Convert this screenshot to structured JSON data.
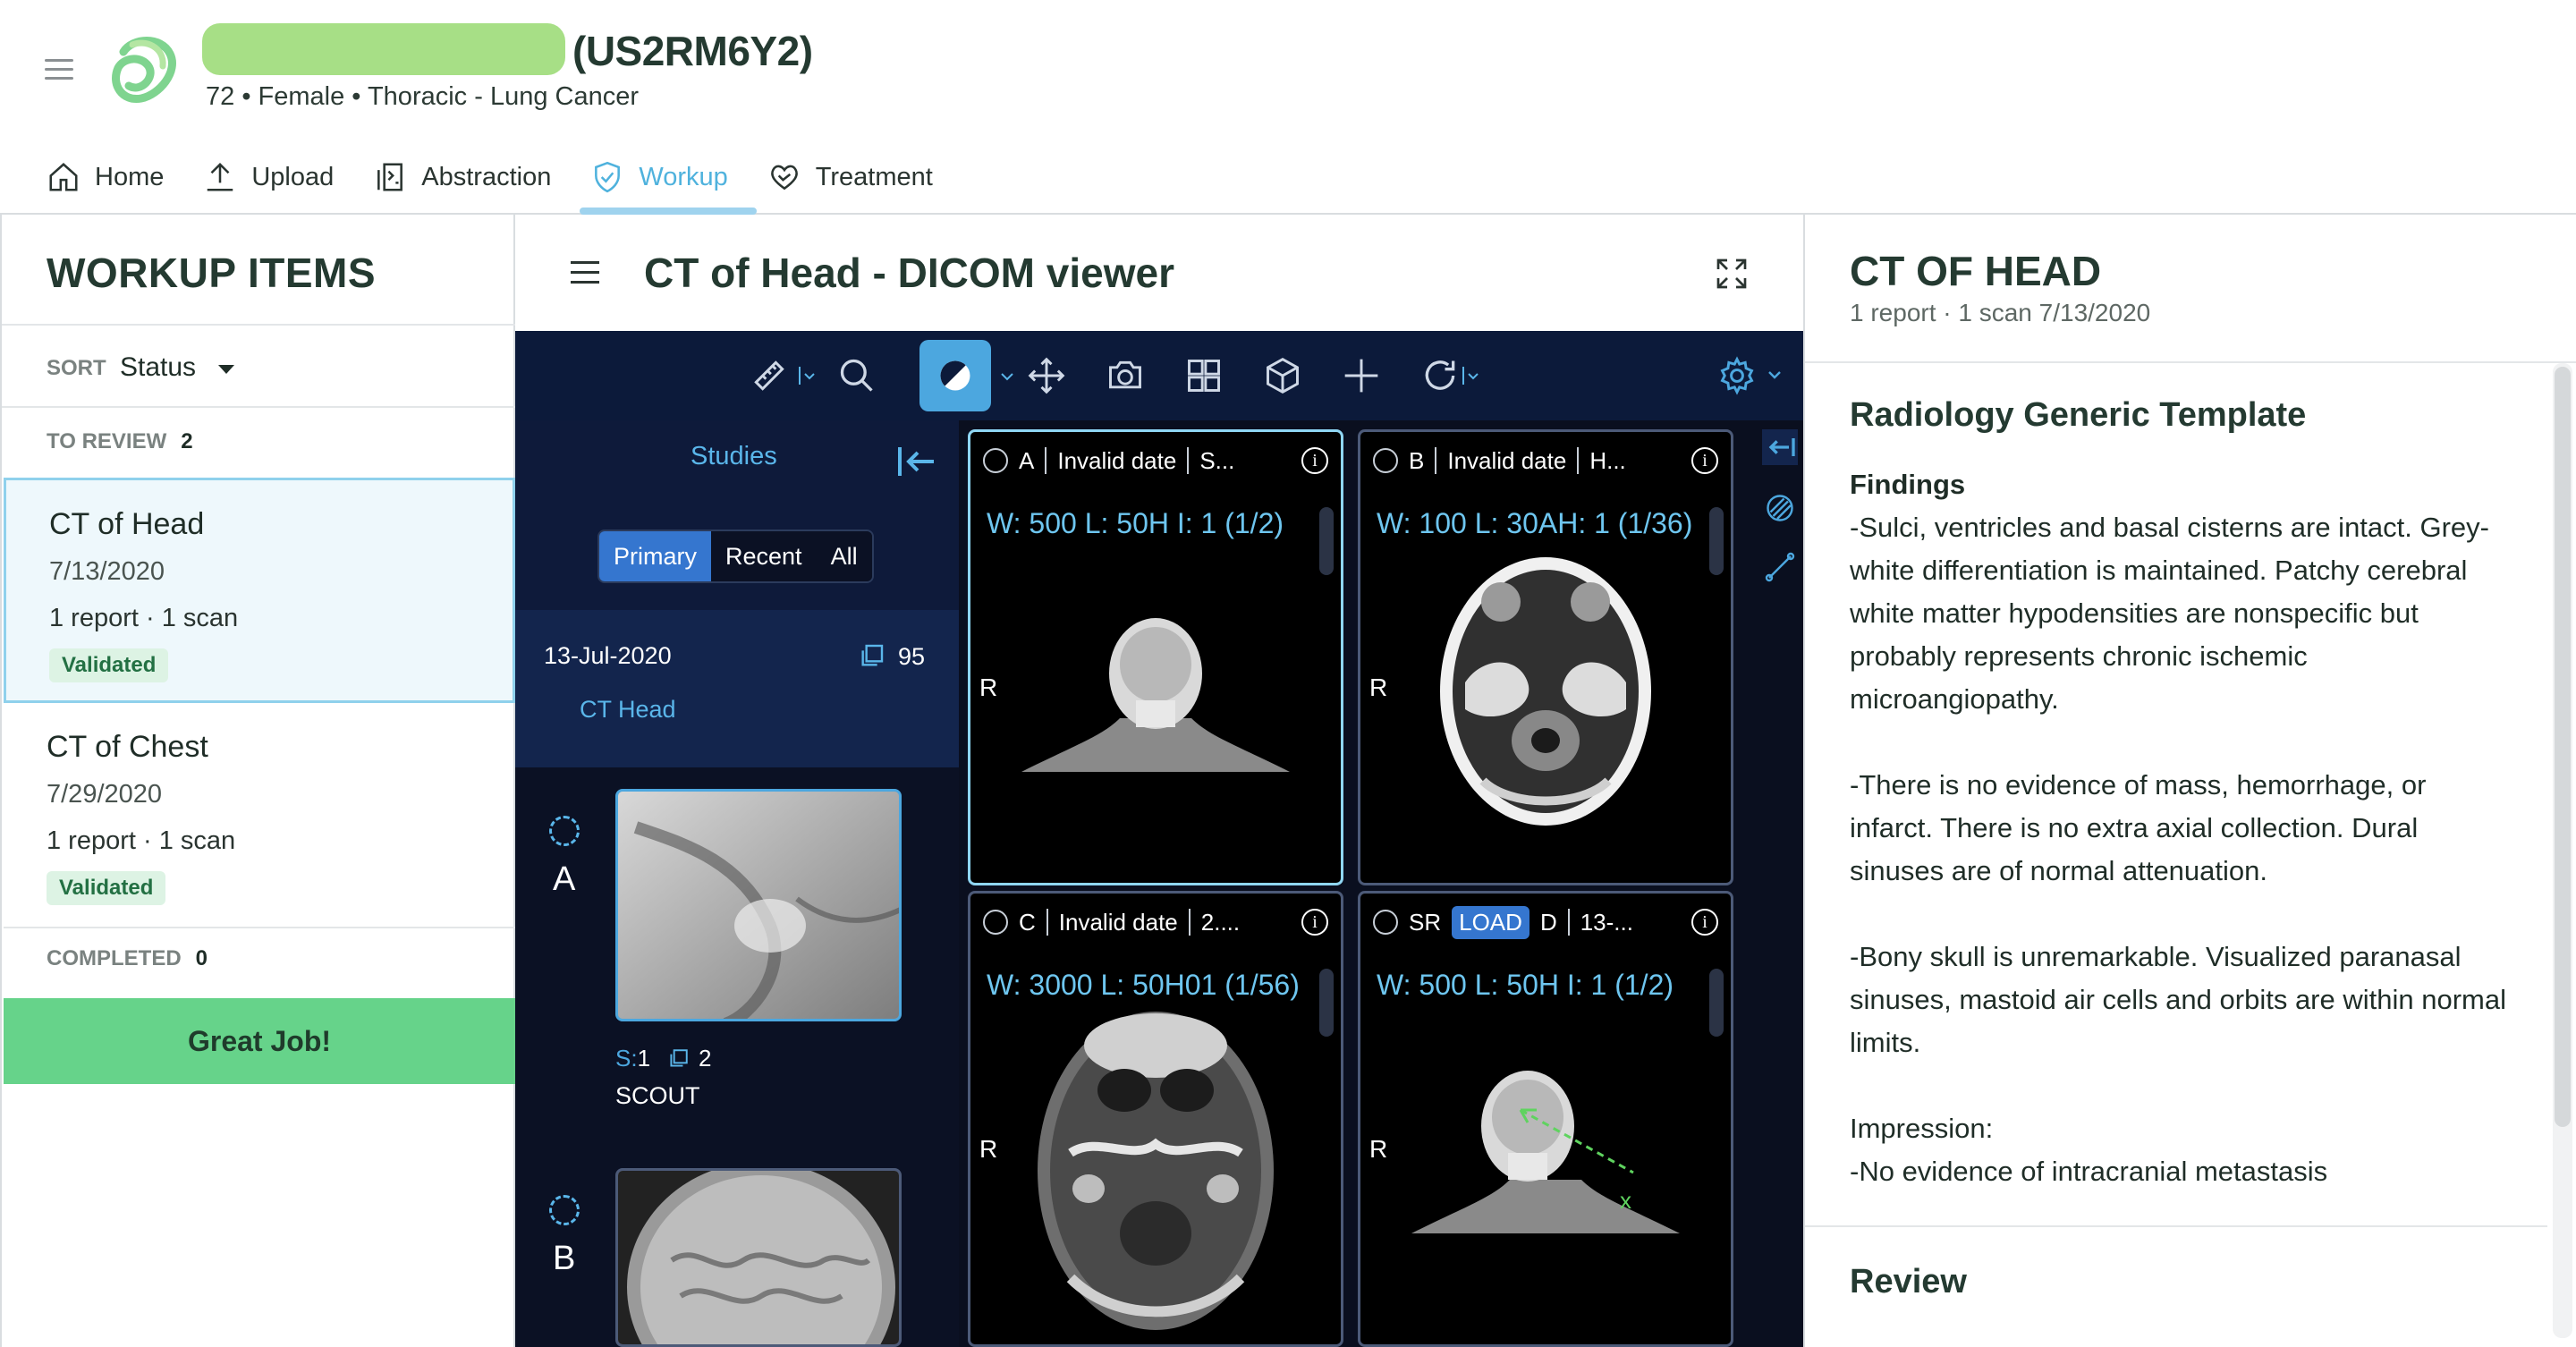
{
  "header": {
    "patient_id": "(US2RM6Y2)",
    "patient_sub": "72 • Female • Thoracic - Lung Cancer"
  },
  "nav": {
    "items": [
      {
        "label": "Home",
        "icon": "home-icon"
      },
      {
        "label": "Upload",
        "icon": "upload-icon"
      },
      {
        "label": "Abstraction",
        "icon": "abstraction-icon"
      },
      {
        "label": "Workup",
        "icon": "shield-check-icon"
      },
      {
        "label": "Treatment",
        "icon": "heart-hand-icon"
      }
    ],
    "active": "Workup",
    "active_color": "#4fb2dd"
  },
  "workup": {
    "title": "WORKUP ITEMS",
    "sort_label": "SORT",
    "sort_value": "Status",
    "to_review_label": "TO REVIEW",
    "to_review_count": "2",
    "items": [
      {
        "title": "CT of Head",
        "date": "7/13/2020",
        "meta": "1 report · 1 scan",
        "status": "Validated"
      },
      {
        "title": "CT of Chest",
        "date": "7/29/2020",
        "meta": "1 report · 1 scan",
        "status": "Validated"
      }
    ],
    "completed_label": "COMPLETED",
    "completed_count": "0",
    "great_job": "Great Job!",
    "accent": "#66d38a"
  },
  "viewer": {
    "title": "CT of Head - DICOM viewer",
    "studies": {
      "title": "Studies",
      "filters": [
        "Primary",
        "Recent",
        "All"
      ],
      "active_filter": "Primary",
      "study_date": "13-Jul-2020",
      "study_count": "95",
      "study_desc": "CT Head"
    },
    "series": [
      {
        "letter": "A",
        "s_label": "S:",
        "s_value": "1",
        "count": "2",
        "name": "SCOUT"
      },
      {
        "letter": "B"
      }
    ],
    "viewports": [
      {
        "label": "A",
        "date": "Invalid date",
        "desc": "S...",
        "wl": "W: 500  L: 50H  I: 1 (1/2)",
        "orient": "R"
      },
      {
        "label": "B",
        "date": "Invalid date",
        "desc": "H...",
        "wl": "W: 100  L: 30AH: 1 (1/36)",
        "orient": "R"
      },
      {
        "label": "C",
        "date": "Invalid date",
        "desc": "2....",
        "wl": "W: 3000  L: 50H01 (1/56)",
        "orient": "R"
      },
      {
        "sr": "SR",
        "load": "LOAD",
        "label": "D",
        "desc": "13-...",
        "wl": "W: 500  L: 50H  I: 1 (1/2)",
        "orient": "R",
        "marker": "x"
      }
    ],
    "toolbar_bg": "#0c1a3a",
    "accent": "#4ca7df"
  },
  "report": {
    "title": "CT OF HEAD",
    "sub": "1 report · 1 scan  7/13/2020",
    "template": "Radiology Generic Template",
    "findings_label": "Findings",
    "findings_1": "-Sulci, ventricles and basal cisterns are intact. Grey-white differentiation is maintained. Patchy cerebral white matter hypodensities are nonspecific but probably represents chronic ischemic microangiopathy.",
    "findings_2": "-There is no evidence of mass, hemorrhage, or infarct. There is no extra axial collection. Dural sinuses are of normal attenuation.",
    "findings_3": "-Bony skull is unremarkable. Visualized paranasal sinuses, mastoid air cells and orbits are within normal limits.",
    "impression_label": "Impression:",
    "impression": "-No evidence of intracranial metastasis",
    "review_label": "Review"
  }
}
